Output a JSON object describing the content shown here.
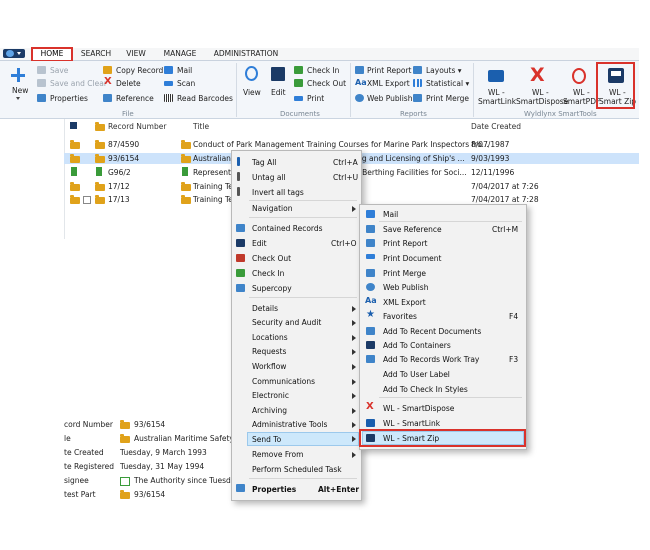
{
  "app": {
    "tabs": [
      "HOME",
      "SEARCH",
      "VIEW",
      "MANAGE",
      "ADMINISTRATION"
    ],
    "active_tab": "HOME"
  },
  "ribbon": {
    "new": "New",
    "file": {
      "save": "Save",
      "save_and_clear": "Save and Clear",
      "properties": "Properties",
      "copy_record": "Copy Record",
      "delete": "Delete",
      "reference": "Reference",
      "mail": "Mail",
      "scan": "Scan",
      "read_barcodes": "Read Barcodes",
      "group": "File"
    },
    "documents": {
      "view": "View",
      "edit": "Edit",
      "check_in": "Check In",
      "check_out": "Check Out",
      "print": "Print",
      "group": "Documents"
    },
    "reports": {
      "print_report": "Print Report",
      "layouts": "Layouts",
      "xml_export": "XML Export",
      "statistical": "Statistical",
      "web_publish": "Web Publish",
      "print_merge": "Print Merge",
      "group": "Reports"
    },
    "wyldlynx": {
      "smartlink": [
        "WL -",
        "SmartLink"
      ],
      "smartdispose": [
        "WL -",
        "SmartDispose"
      ],
      "smartpdf": [
        "WL -",
        "SmartPDF"
      ],
      "smartzip": [
        "WL -",
        "Smart Zip"
      ],
      "group": "Wyldlynx SmartTools"
    }
  },
  "list": {
    "headers": {
      "record_number": "Record Number",
      "title": "Title",
      "date_created": "Date Created"
    },
    "rows": [
      {
        "number": "87/4590",
        "title": "Conduct of Park Management Training Courses for Marine Park Inspectors fro...",
        "date": "8/07/1987"
      },
      {
        "number": "93/6154",
        "title": "Australian M",
        "title_tail": "ing and Licensing of Ship's ...",
        "date": "9/03/1993"
      },
      {
        "number": "G96/2",
        "title": "Representa",
        "title_tail": "g Berthing Facilities for Soci...",
        "date": "12/11/1996"
      },
      {
        "number": "17/12",
        "title": "Training Tes",
        "date": "7/04/2017 at 7:26"
      },
      {
        "number": "17/13",
        "title": "Training Tes",
        "date": "7/04/2017 at 7:28"
      }
    ]
  },
  "properties": {
    "rows": [
      {
        "label": "cord Number",
        "value": "93/6154"
      },
      {
        "label": "le",
        "value": "Australian Maritime Safety A"
      },
      {
        "label": "te Created",
        "value": "Tuesday, 9 March 1993"
      },
      {
        "label": "te Registered",
        "value": "Tuesday, 31 May 1994"
      },
      {
        "label": "signee",
        "value": "The Authority since Tuesday,"
      },
      {
        "label": "test Part",
        "value": "93/6154"
      }
    ]
  },
  "context_menu": {
    "tag_all": "Tag All",
    "tag_all_sc": "Ctrl+A",
    "untag_all": "Untag all",
    "untag_all_sc": "Ctrl+U",
    "invert": "Invert all tags",
    "navigation": "Navigation",
    "contained": "Contained Records",
    "edit": "Edit",
    "edit_sc": "Ctrl+O",
    "check_out": "Check Out",
    "check_in": "Check In",
    "supercopy": "Supercopy",
    "details": "Details",
    "security": "Security and Audit",
    "locations": "Locations",
    "requests": "Requests",
    "workflow": "Workflow",
    "communications": "Communications",
    "electronic": "Electronic",
    "archiving": "Archiving",
    "admin_tools": "Administrative Tools",
    "send_to": "Send To",
    "remove_from": "Remove From",
    "scheduled": "Perform Scheduled Task",
    "properties": "Properties",
    "properties_sc": "Alt+Enter"
  },
  "send_to_menu": {
    "mail": "Mail",
    "save_reference": "Save Reference",
    "save_reference_sc": "Ctrl+M",
    "print_report": "Print Report",
    "print_document": "Print Document",
    "print_merge": "Print Merge",
    "web_publish": "Web Publish",
    "xml_export": "XML Export",
    "favorites": "Favorites",
    "favorites_sc": "F4",
    "recent_docs": "Add To Recent Documents",
    "containers": "Add To Containers",
    "work_tray": "Add To Records Work Tray",
    "work_tray_sc": "F3",
    "user_label": "Add To User Label",
    "check_in_styles": "Add To Check In Styles",
    "smartdispose": "WL - SmartDispose",
    "smartlink": "WL - SmartLink",
    "smartzip": "WL - Smart Zip"
  },
  "colors": {
    "accent_red": "#d9322b",
    "selection": "#cde8fb",
    "folder": "#e0a21a",
    "brand_blue": "#1b5fae"
  }
}
